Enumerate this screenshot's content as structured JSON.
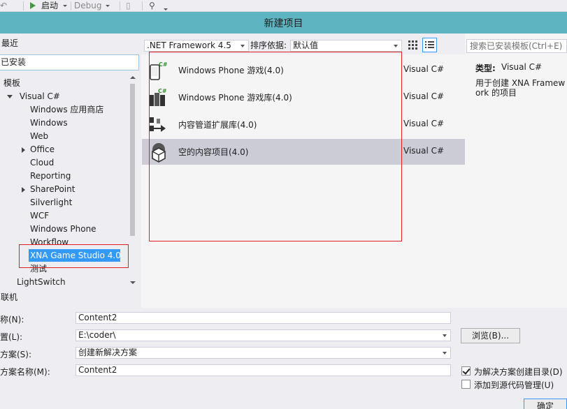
{
  "toolbar": {
    "start_label": "启动",
    "config_label": "Debug"
  },
  "dialog": {
    "title": "新建项目"
  },
  "sidebar": {
    "recent_label": "最近",
    "installed_label": "已安装",
    "templates_label": "模板",
    "visual_csharp_label": "Visual C#",
    "items": [
      {
        "label": "Windows 应用商店",
        "expandable": false
      },
      {
        "label": "Windows",
        "expandable": false
      },
      {
        "label": "Web",
        "expandable": false
      },
      {
        "label": "Office",
        "expandable": true
      },
      {
        "label": "Cloud",
        "expandable": false
      },
      {
        "label": "Reporting",
        "expandable": false
      },
      {
        "label": "SharePoint",
        "expandable": true
      },
      {
        "label": "Silverlight",
        "expandable": false
      },
      {
        "label": "WCF",
        "expandable": false
      },
      {
        "label": "Windows Phone",
        "expandable": false
      },
      {
        "label": "Workflow",
        "expandable": false
      },
      {
        "label": "XNA Game Studio 4.0",
        "expandable": false,
        "selected": true
      },
      {
        "label": "测试",
        "expandable": false
      },
      {
        "label": "LightSwitch",
        "expandable": false
      }
    ],
    "online_label": "联机"
  },
  "filters": {
    "framework": ".NET Framework 4.5",
    "sort_label": "排序依据:",
    "sort_value": "默认值"
  },
  "templates": [
    {
      "name": "Windows Phone 游戏(4.0)",
      "lang": "Visual C#",
      "icon": "phone-game-icon",
      "selected": false
    },
    {
      "name": "Windows Phone 游戏库(4.0)",
      "lang": "Visual C#",
      "icon": "game-library-icon",
      "selected": false
    },
    {
      "name": "内容管道扩展库(4.0)",
      "lang": "Visual C#",
      "icon": "content-pipeline-icon",
      "selected": false
    },
    {
      "name": "空的内容项目(4.0)",
      "lang": "Visual C#",
      "icon": "content-project-icon",
      "selected": true
    }
  ],
  "details": {
    "search_placeholder": "搜索已安装模板(Ctrl+E)",
    "type_label": "类型:",
    "type_value": "Visual C#",
    "description": "用于创建 XNA Framework 的项目"
  },
  "form": {
    "name_label": "名称(N):",
    "name_value": "Content2",
    "location_label": "位置(L):",
    "location_value": "E:\\coder\\",
    "browse_label": "浏览(B)...",
    "solution_label": "解决方案(S):",
    "solution_value": "创建新解决方案",
    "solution_name_label": "解决方案名称(M):",
    "solution_name_value": "Content2",
    "create_dir_label": "为解决方案创建目录(D)",
    "create_dir_checked": true,
    "source_control_label": "添加到源代码管理(U)",
    "source_control_checked": false,
    "ok_label": "确定"
  },
  "colors": {
    "title_bar": "#5fb4c2",
    "selection": "#3399ff",
    "highlight_box": "#e02020"
  }
}
